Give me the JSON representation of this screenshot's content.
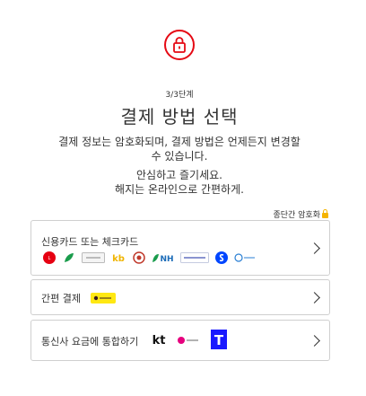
{
  "step": "3/3단계",
  "title": "결제 방법 선택",
  "description": [
    "결제 정보는 암호화되며, 결제 방법은 언제든지 변경할",
    "수 있습니다."
  ],
  "reassurance": [
    "안심하고 즐기세요.",
    "해지는 온라인으로 간편하게."
  ],
  "secure_label": "종단간 암호화",
  "options": [
    {
      "label": "신용카드 또는 체크카드"
    },
    {
      "label": "간편 결제"
    },
    {
      "label": "통신사 요금에 통합하기"
    }
  ],
  "card_logos": [
    "lotte",
    "nh-leaf",
    "hyundai",
    "kb",
    "hana",
    "NH",
    "Samsung Card",
    "shinhan",
    "woori"
  ],
  "telco_logos": [
    "kt",
    "LG U+",
    "T"
  ],
  "colors": {
    "accent": "#e50914",
    "kakao": "#ffe812"
  }
}
